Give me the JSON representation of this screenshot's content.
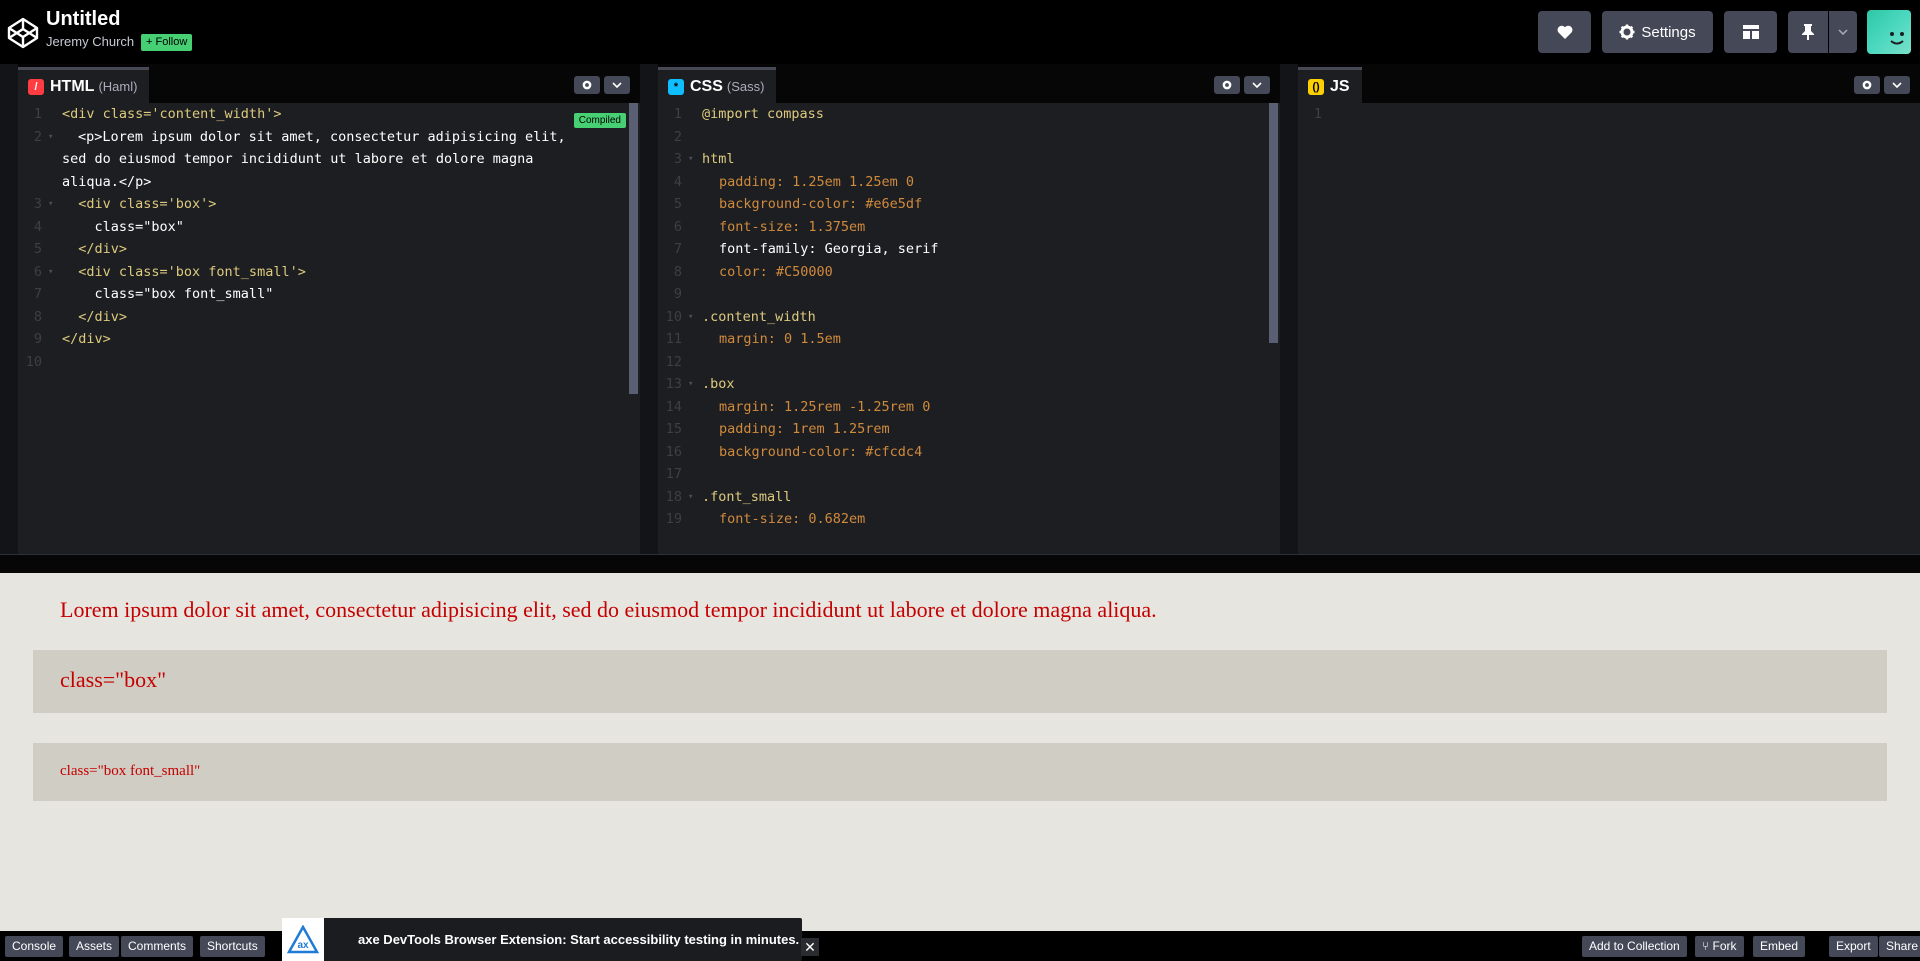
{
  "header": {
    "title": "Untitled",
    "author": "Jeremy Church",
    "follow_label": "+ Follow",
    "settings_label": "Settings"
  },
  "editors": {
    "html": {
      "name": "HTML",
      "preprocessor": "(Haml)",
      "badge": "Compiled",
      "line_numbers": [
        "1",
        "2",
        "3",
        "4",
        "5",
        "6",
        "7",
        "8",
        "9",
        "10"
      ],
      "lines": [
        "<div class='content_width'>",
        "<p>Lorem ipsum dolor sit amet, consectetur adipisicing elit, sed do eiusmod tempor incididunt ut labore et dolore magna aliqua.</p>",
        "  <div class='box'>",
        "    class=\"box\"",
        "  </div>",
        "  <div class='box font_small'>",
        "    class=\"box font_small\"",
        "  </div>",
        "</div>",
        ""
      ]
    },
    "css": {
      "name": "CSS",
      "preprocessor": "(Sass)",
      "line_numbers": [
        "1",
        "2",
        "3",
        "4",
        "5",
        "6",
        "7",
        "8",
        "9",
        "10",
        "11",
        "12",
        "13",
        "14",
        "15",
        "16",
        "17",
        "18",
        "19"
      ],
      "lines": [
        "@import compass",
        "",
        "html",
        "padding: 1.25em 1.25em 0",
        "background-color: #e6e5df",
        "font-size: 1.375em",
        "font-family: Georgia, serif",
        "color: #C50000",
        "",
        ".content_width",
        "margin: 0 1.5em",
        "",
        ".box",
        "margin: 1.25rem -1.25rem 0",
        "padding: 1rem 1.25rem",
        "background-color: #cfcdc4",
        "",
        ".font_small",
        "font-size: 0.682em"
      ]
    },
    "js": {
      "name": "JS",
      "line_numbers": [
        "1"
      ]
    }
  },
  "preview": {
    "paragraph": "Lorem ipsum dolor sit amet, consectetur adipisicing elit, sed do eiusmod tempor incididunt ut labore et dolore magna aliqua.",
    "box": "class=\"box\"",
    "box_small": "class=\"box font_small\""
  },
  "footer": {
    "console": "Console",
    "assets": "Assets",
    "comments": "Comments",
    "shortcuts": "Shortcuts",
    "ad_text": "axe DevTools Browser Extension: Start accessibility testing in minutes.",
    "add_to_collection": "Add to Collection",
    "fork": "Fork",
    "embed": "Embed",
    "export": "Export",
    "share": "Share"
  },
  "colors": {
    "accent_green": "#47cf73",
    "preview_bg": "#e6e5df",
    "box_bg": "#cfcdc4",
    "preview_text": "#c50000"
  },
  "icons": [
    "codepen-logo-icon",
    "heart-icon",
    "gear-icon",
    "layout-icon",
    "pin-icon",
    "chevron-down-icon",
    "close-icon",
    "axe-logo-icon",
    "fork-icon"
  ]
}
